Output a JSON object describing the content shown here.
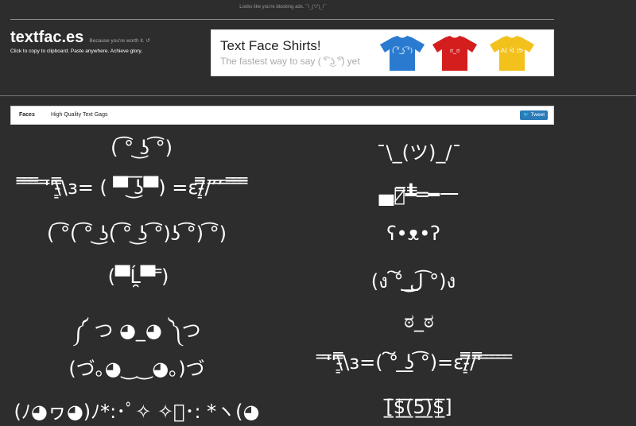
{
  "top_notice": "Looks like you're blocking ads. ¯\\_(ツ)_/¯",
  "brand": {
    "title": "textfac.es",
    "tagline": "Because you're worth it. ↺",
    "subtitle": "Click to copy to clipboard. Paste anywhere. Achieve glory."
  },
  "ad": {
    "title": "Text Face Shirts!",
    "subtitle": "The fastest way to say ( ͡° ͜ʖ ͡°) yet",
    "shirts": [
      {
        "color": "#2a7bd0",
        "face": "( ͡° ͜ʖ ͡°)"
      },
      {
        "color": "#d41e1e",
        "face": "ಠ_ಠ"
      },
      {
        "color": "#f2c11b",
        "face": "ᕕ( ᐛ )ᕗ"
      }
    ]
  },
  "nav": {
    "tabs": [
      "Faces",
      "High Quality Text Gags"
    ],
    "tweet_label": "Tweet"
  },
  "faces": {
    "left": [
      "( ͡° ͜ʖ ͡°)",
      "̿̿ ̿̿ ̿̿ ̿'̿'\\̵͇̿̿\\з= ( ▀ ͜͞ʖ▀) =ε/̵͇̿̿/’̿’̿ ̿ ̿̿ ̿̿ ̿̿",
      "( ͡°( ͡° ͜ʖ( ͡° ͜ʖ ͡°)ʖ ͡°) ͡°)",
      "(▀̿Ĺ̯▀̿ ̿)",
      "༼ つ ◕_◕ ༽つ",
      "(づ｡◕‿‿◕｡)づ",
      "(ﾉ◕ヮ◕)ﾉ*:･ﾟ✧ ✧ﾟ･: *ヽ(◕"
    ],
    "right": [
      "¯\\_(ツ)_/¯",
      "▄︻̷̿┻̿═━一",
      "ʕ•ᴥ•ʔ",
      "(ง ͠° ͟ل͜ ͡°)ง",
      "ಠ_ಠ",
      "̿'̿'\\̵͇̿̿\\з=( ͠° ͟ʖ ͡°)=ε/̵͇̿̿/'̿̿ ̿ ̿ ̿ ̿ ̿",
      "[̲̅$̲̅(̲̅5̲̅)̲̅$̲̅]"
    ]
  }
}
